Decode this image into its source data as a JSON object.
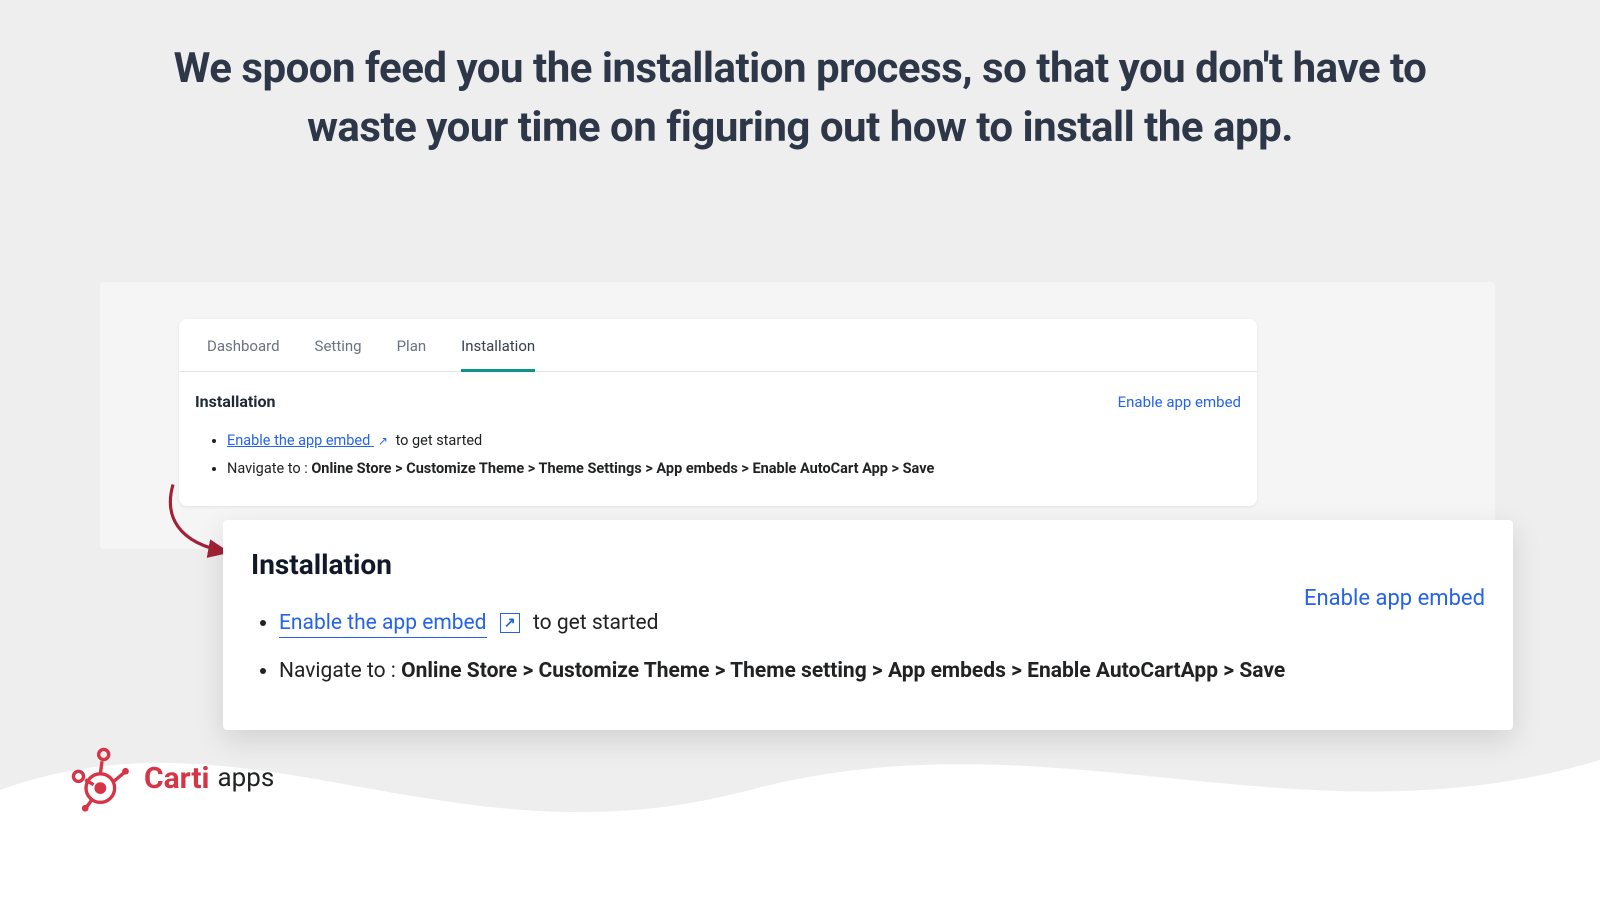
{
  "headline": "We spoon feed you the installation process, so that you don't have to waste your time on figuring out how to install the app.",
  "tabs": {
    "dashboard": "Dashboard",
    "setting": "Setting",
    "plan": "Plan",
    "installation": "Installation"
  },
  "card1": {
    "title": "Installation",
    "enable": "Enable app embed",
    "bullet1_link": "Enable the app embed ",
    "bullet1_rest": "to get started",
    "bullet2_pre": "Navigate to : ",
    "bullet2_bold": "Online Store > Customize Theme > Theme Settings > App embeds > Enable AutoCart App > Save"
  },
  "card2": {
    "title": "Installation",
    "enable": "Enable app embed",
    "bullet1_link": "Enable the app embed",
    "bullet1_rest": "to get started",
    "bullet2_pre": "Navigate to : ",
    "bullet2_bold": "Online Store > Customize Theme > Theme setting > App embeds > Enable AutoCartApp > Save"
  },
  "logo": {
    "brand": "Carti",
    "suffix": "apps"
  },
  "colors": {
    "accent": "#d63447",
    "link": "#2563eb",
    "tab_active": "#0d9488"
  }
}
